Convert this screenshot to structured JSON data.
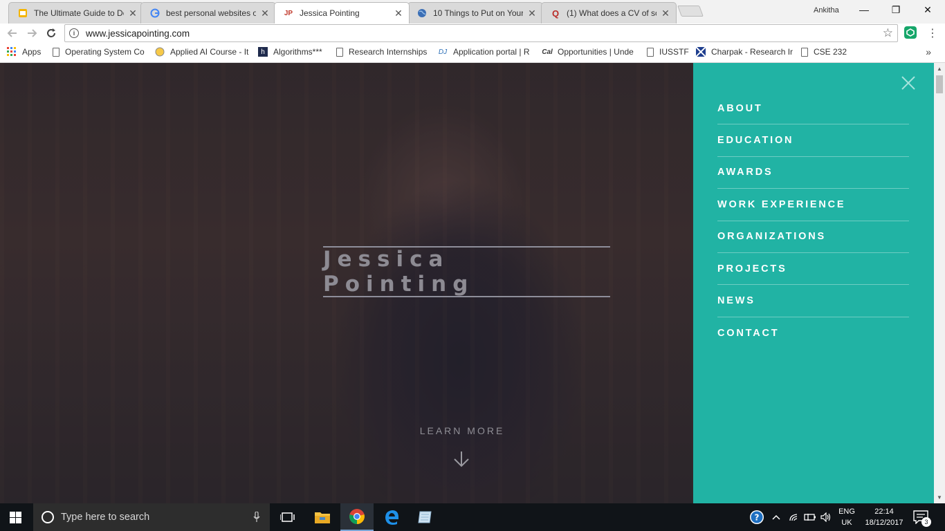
{
  "browser": {
    "tabs": [
      {
        "title": "The Ultimate Guide to De",
        "favicon": "slides-icon",
        "active": false
      },
      {
        "title": "best personal websites o",
        "favicon": "google-icon",
        "active": false
      },
      {
        "title": "Jessica Pointing",
        "favicon_text": "JP",
        "active": true
      },
      {
        "title": "10 Things to Put on Your",
        "favicon": "globe-icon",
        "active": false
      },
      {
        "title": "(1) What does a CV of sc",
        "favicon_text": "Q",
        "active": false
      }
    ],
    "profile_name": "Ankitha",
    "window_controls": {
      "minimize": "—",
      "restore": "❐",
      "close": "✕"
    },
    "url": "www.jessicapointing.com",
    "bookmarks": [
      {
        "label": "Apps"
      },
      {
        "label": "Operating System Co"
      },
      {
        "label": "Applied AI Course - It"
      },
      {
        "label": "Algorithms***"
      },
      {
        "label": "Research Internships"
      },
      {
        "label": "Application portal | R"
      },
      {
        "label": "Opportunities | Unde"
      },
      {
        "label": "IUSSTF"
      },
      {
        "label": "Charpak - Research Ir"
      },
      {
        "label": "CSE 232"
      }
    ],
    "bookmark_more": "»",
    "colors": {
      "tabstrip": "#f2f2f2",
      "ext_green": "#16a66a"
    }
  },
  "page": {
    "hero_name": "Jessica Pointing",
    "learn_more": "LEARN MORE",
    "menu": {
      "items": [
        "ABOUT",
        "EDUCATION",
        "AWARDS",
        "WORK EXPERIENCE",
        "ORGANIZATIONS",
        "PROJECTS",
        "NEWS",
        "CONTACT"
      ],
      "background_color": "#21b3a4"
    }
  },
  "taskbar": {
    "search_placeholder": "Type here to search",
    "language_line1": "ENG",
    "language_line2": "UK",
    "time": "22:14",
    "date": "18/12/2017",
    "notification_count": "3",
    "apps": [
      "task-view-icon",
      "file-explorer-icon",
      "chrome-icon",
      "edge-icon",
      "notes-icon"
    ]
  }
}
